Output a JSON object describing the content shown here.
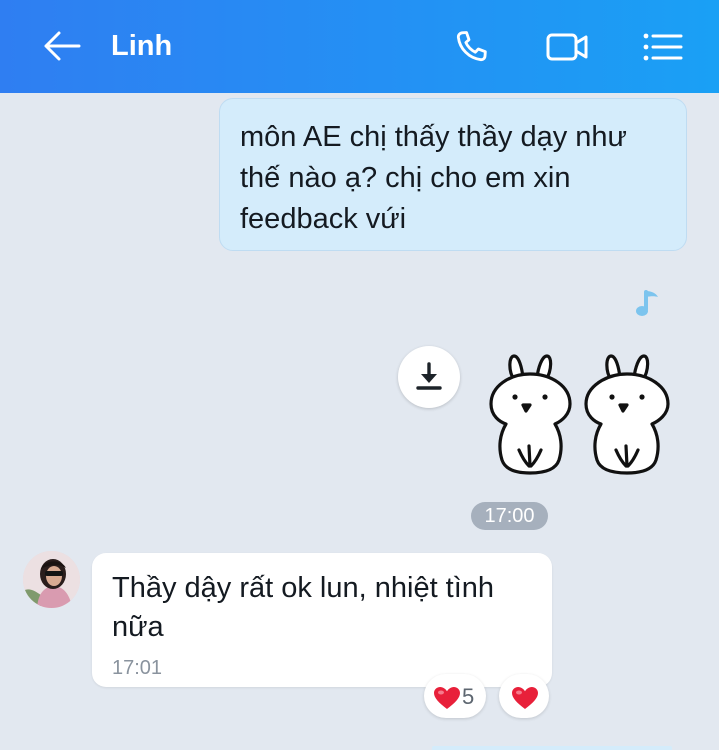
{
  "header": {
    "title": "Linh",
    "back_icon": "arrow-left-icon",
    "call_icon": "phone-icon",
    "video_icon": "video-camera-icon",
    "menu_icon": "list-menu-icon",
    "gradient_start": "#2f7ef2",
    "gradient_end": "#1aa0f5"
  },
  "messages": {
    "outgoing_text": "môn AE chị thấy thầy dạy như thế nào ạ? chị cho em xin feedback vứi",
    "music_icon": "music-note-icon",
    "download_icon": "download-icon",
    "sticker": "rabbit-pair-sticker",
    "time_separator": "17:00",
    "incoming_text": "Thầy dậy rất ok lun, nhiệt tình nữa",
    "incoming_time": "17:01"
  },
  "reactions": [
    {
      "icon": "heart-icon",
      "count": "5"
    },
    {
      "icon": "heart-icon",
      "count": ""
    }
  ],
  "colors": {
    "background": "#e2e8f0",
    "outgoing_bubble": "#d4ecfb",
    "incoming_bubble": "#ffffff",
    "heart": "#e8203a"
  }
}
